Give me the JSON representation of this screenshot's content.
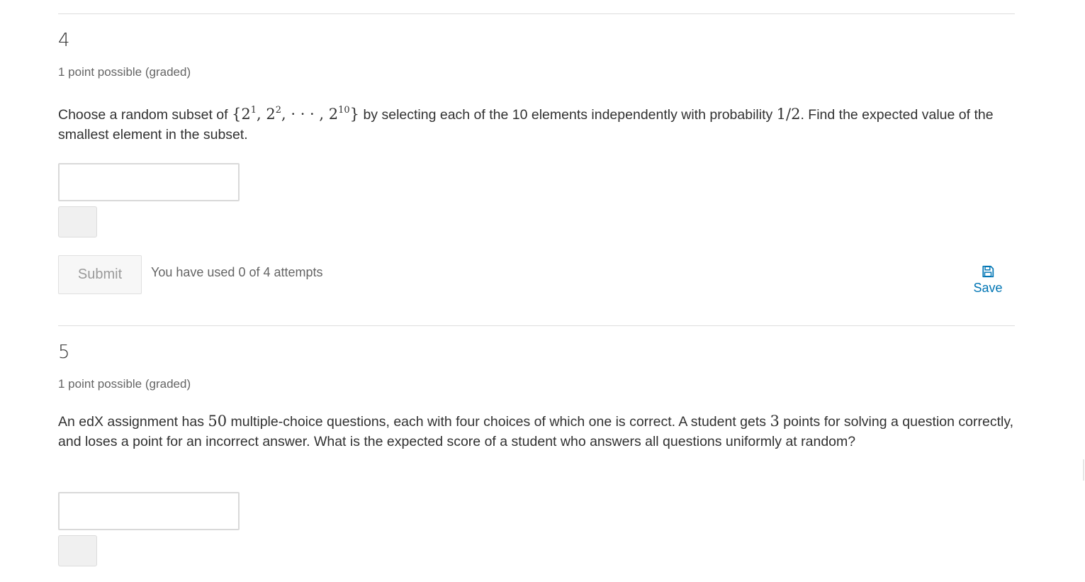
{
  "problem4": {
    "number": "4",
    "points": "1 point possible (graded)",
    "prompt_part1": "Choose a random subset of ",
    "math_set_open": "{2",
    "math_sup1": "1",
    "math_sep1": ", 2",
    "math_sup2": "2",
    "math_sep2": ", · · · , 2",
    "math_sup10": "10",
    "math_set_close": "}",
    "prompt_part2": " by selecting each of the 10 elements independently with probability ",
    "math_prob": "1/2",
    "prompt_part3": ". Find the expected value of the smallest element in the subset.",
    "answer_value": ""
  },
  "submit": {
    "label": "Submit",
    "attempts_text": "You have used 0 of 4 attempts"
  },
  "save": {
    "label": "Save",
    "icon": "floppy-disk-icon",
    "color": "#0075b4"
  },
  "problem5": {
    "number": "5",
    "points": "1 point possible (graded)",
    "prompt_part1": "An edX assignment has ",
    "math_n": "50",
    "prompt_part2": " multiple-choice questions, each with four choices of which one is correct. A student gets ",
    "math_pts": "3",
    "prompt_part3": " points for solving a question correctly, and loses a point for an incorrect answer. What is the expected score of a student who answers all questions uniformly at random?",
    "answer_value": ""
  }
}
